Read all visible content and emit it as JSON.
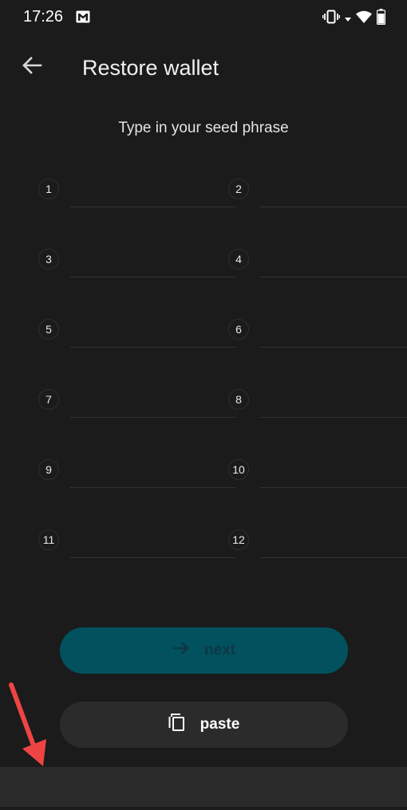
{
  "status_bar": {
    "time": "17:26",
    "notification_icons": [
      "gmail-icon"
    ],
    "system_icons": [
      "vibrate-icon",
      "wifi-icon",
      "battery-icon"
    ]
  },
  "header": {
    "title": "Restore wallet",
    "back_icon": "arrow-left-icon"
  },
  "subtitle": "Type in your seed phrase",
  "seed_words": [
    {
      "number": "1",
      "value": ""
    },
    {
      "number": "2",
      "value": ""
    },
    {
      "number": "3",
      "value": ""
    },
    {
      "number": "4",
      "value": ""
    },
    {
      "number": "5",
      "value": ""
    },
    {
      "number": "6",
      "value": ""
    },
    {
      "number": "7",
      "value": ""
    },
    {
      "number": "8",
      "value": ""
    },
    {
      "number": "9",
      "value": ""
    },
    {
      "number": "10",
      "value": ""
    },
    {
      "number": "11",
      "value": ""
    },
    {
      "number": "12",
      "value": ""
    }
  ],
  "buttons": {
    "next": {
      "label": "next",
      "icon": "arrow-right-icon",
      "disabled": true
    },
    "paste": {
      "label": "paste",
      "icon": "copy-icon"
    }
  },
  "annotation": {
    "icon": "red-arrow-icon",
    "color": "#ef4444"
  },
  "colors": {
    "background": "#1b1b1c",
    "next_button": "#02515e",
    "paste_button": "#2b2b2c",
    "nav_bar": "#2b2b2c"
  }
}
